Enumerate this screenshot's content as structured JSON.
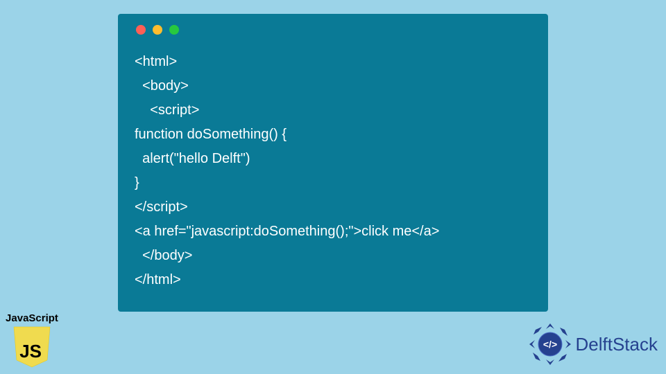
{
  "code": {
    "lines": [
      "<html>",
      "  <body>",
      "    <script>",
      "function doSomething() {",
      "  alert(\"hello Delft\")",
      "}",
      "</script>",
      "<a href=\"javascript:doSomething();\">click me</a>",
      "  </body>",
      "</html>"
    ]
  },
  "badges": {
    "js_label": "JavaScript",
    "js_shield_text": "JS",
    "delft_text": "DelftStack",
    "delft_logo_glyph": "</>"
  },
  "colors": {
    "page_bg": "#9bd3e8",
    "window_bg": "#0a7a96",
    "code_text": "#ffffff",
    "js_shield": "#f0db4f",
    "js_shield_text": "#000000",
    "delft_primary": "#25418f"
  }
}
